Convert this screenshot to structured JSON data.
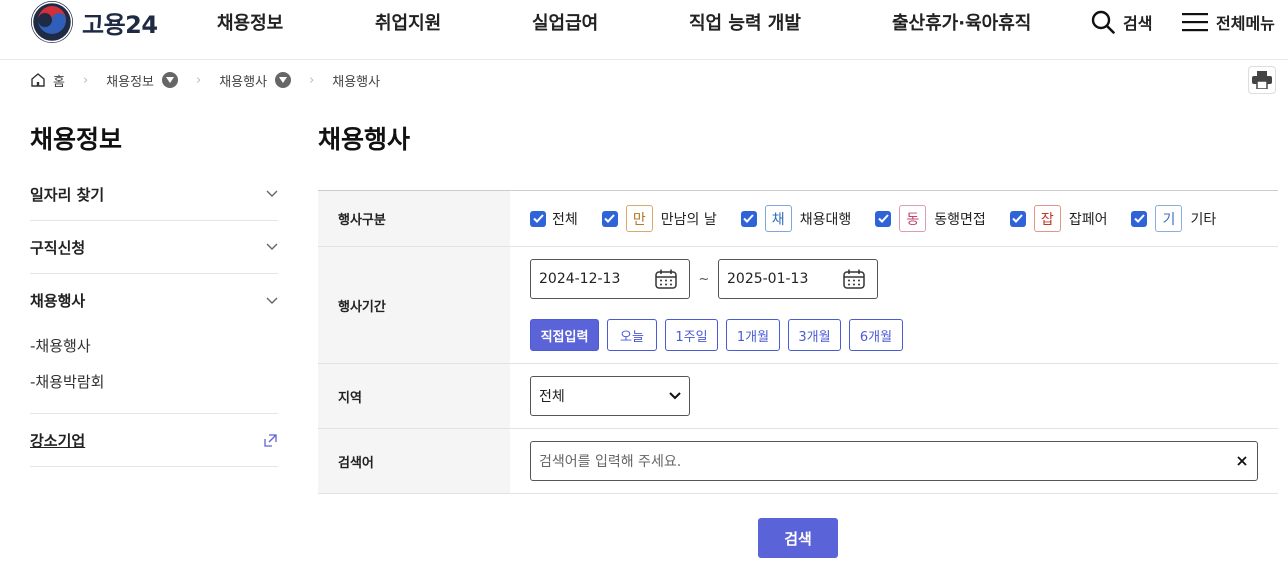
{
  "header": {
    "logo_text": "고용24",
    "nav": [
      "채용정보",
      "취업지원",
      "실업급여",
      "직업 능력 개발",
      "출산휴가·육아휴직"
    ],
    "search_label": "검색",
    "all_menu_label": "전체메뉴"
  },
  "breadcrumb": {
    "home": "홈",
    "level1": "채용정보",
    "level2": "채용행사",
    "current": "채용행사"
  },
  "sidebar": {
    "title": "채용정보",
    "items": [
      {
        "label": "일자리 찾기"
      },
      {
        "label": "구직신청"
      },
      {
        "label": "채용행사"
      }
    ],
    "sub_items": [
      "-채용행사",
      "-채용박람회"
    ],
    "external": {
      "label": "강소기업"
    }
  },
  "main": {
    "title": "채용행사",
    "type_label": "행사구분",
    "types": [
      {
        "label": "전체",
        "checked": true
      },
      {
        "badge": "만",
        "label": "만남의 날",
        "color": "#b8742a",
        "checked": true
      },
      {
        "badge": "채",
        "label": "채용대행",
        "color": "#2f6fb8",
        "checked": true
      },
      {
        "badge": "동",
        "label": "동행면접",
        "color": "#c0446c",
        "checked": true
      },
      {
        "badge": "잡",
        "label": "잡페어",
        "color": "#c0392b",
        "checked": true
      },
      {
        "badge": "기",
        "label": "기타",
        "color": "#3a6fc4",
        "checked": true
      }
    ],
    "period_label": "행사기간",
    "date_from": "2024-12-13",
    "date_to": "2025-01-13",
    "tilde": "~",
    "period_buttons": [
      {
        "label": "직접입력",
        "active": true
      },
      {
        "label": "오늘",
        "active": false
      },
      {
        "label": "1주일",
        "active": false
      },
      {
        "label": "1개월",
        "active": false
      },
      {
        "label": "3개월",
        "active": false
      },
      {
        "label": "6개월",
        "active": false
      }
    ],
    "region_label": "지역",
    "region_value": "전체",
    "keyword_label": "검색어",
    "keyword_placeholder": "검색어를 입력해 주세요.",
    "submit_label": "검색"
  },
  "colors": {
    "accent": "#5b63d8",
    "checkbox": "#2f64d8"
  }
}
